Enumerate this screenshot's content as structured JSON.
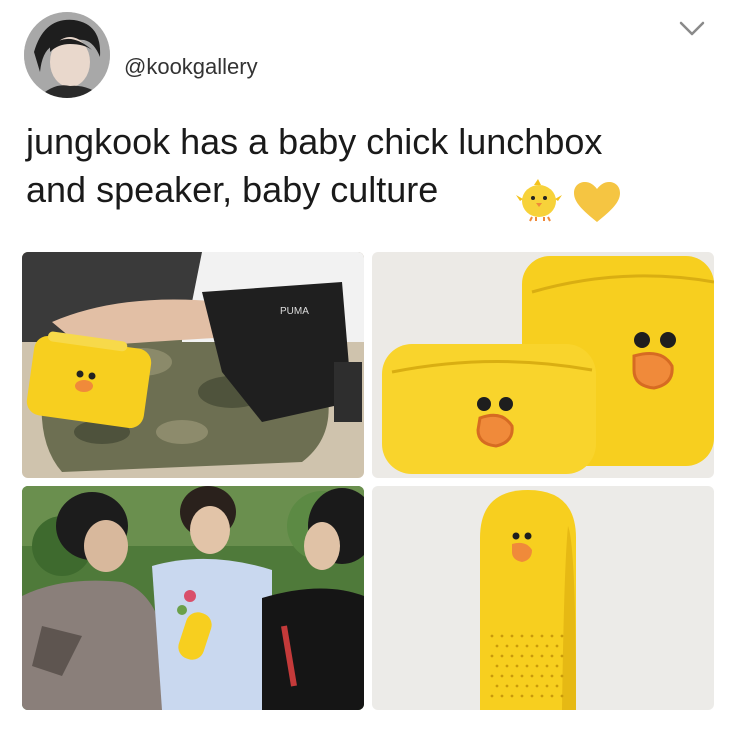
{
  "post": {
    "handle": "@kookgallery",
    "text_line1": "jungkook has a baby chick lunchbox",
    "text_line2": "and speaker, baby culture",
    "emojis": [
      "chick-emoji",
      "yellow-heart-emoji"
    ]
  },
  "header": {
    "menu_icon": "chevron-down-icon"
  },
  "colors": {
    "brand_yellow": "#f7cf1f",
    "beak_orange": "#f08a3a",
    "heart_yellow": "#f5c542"
  }
}
